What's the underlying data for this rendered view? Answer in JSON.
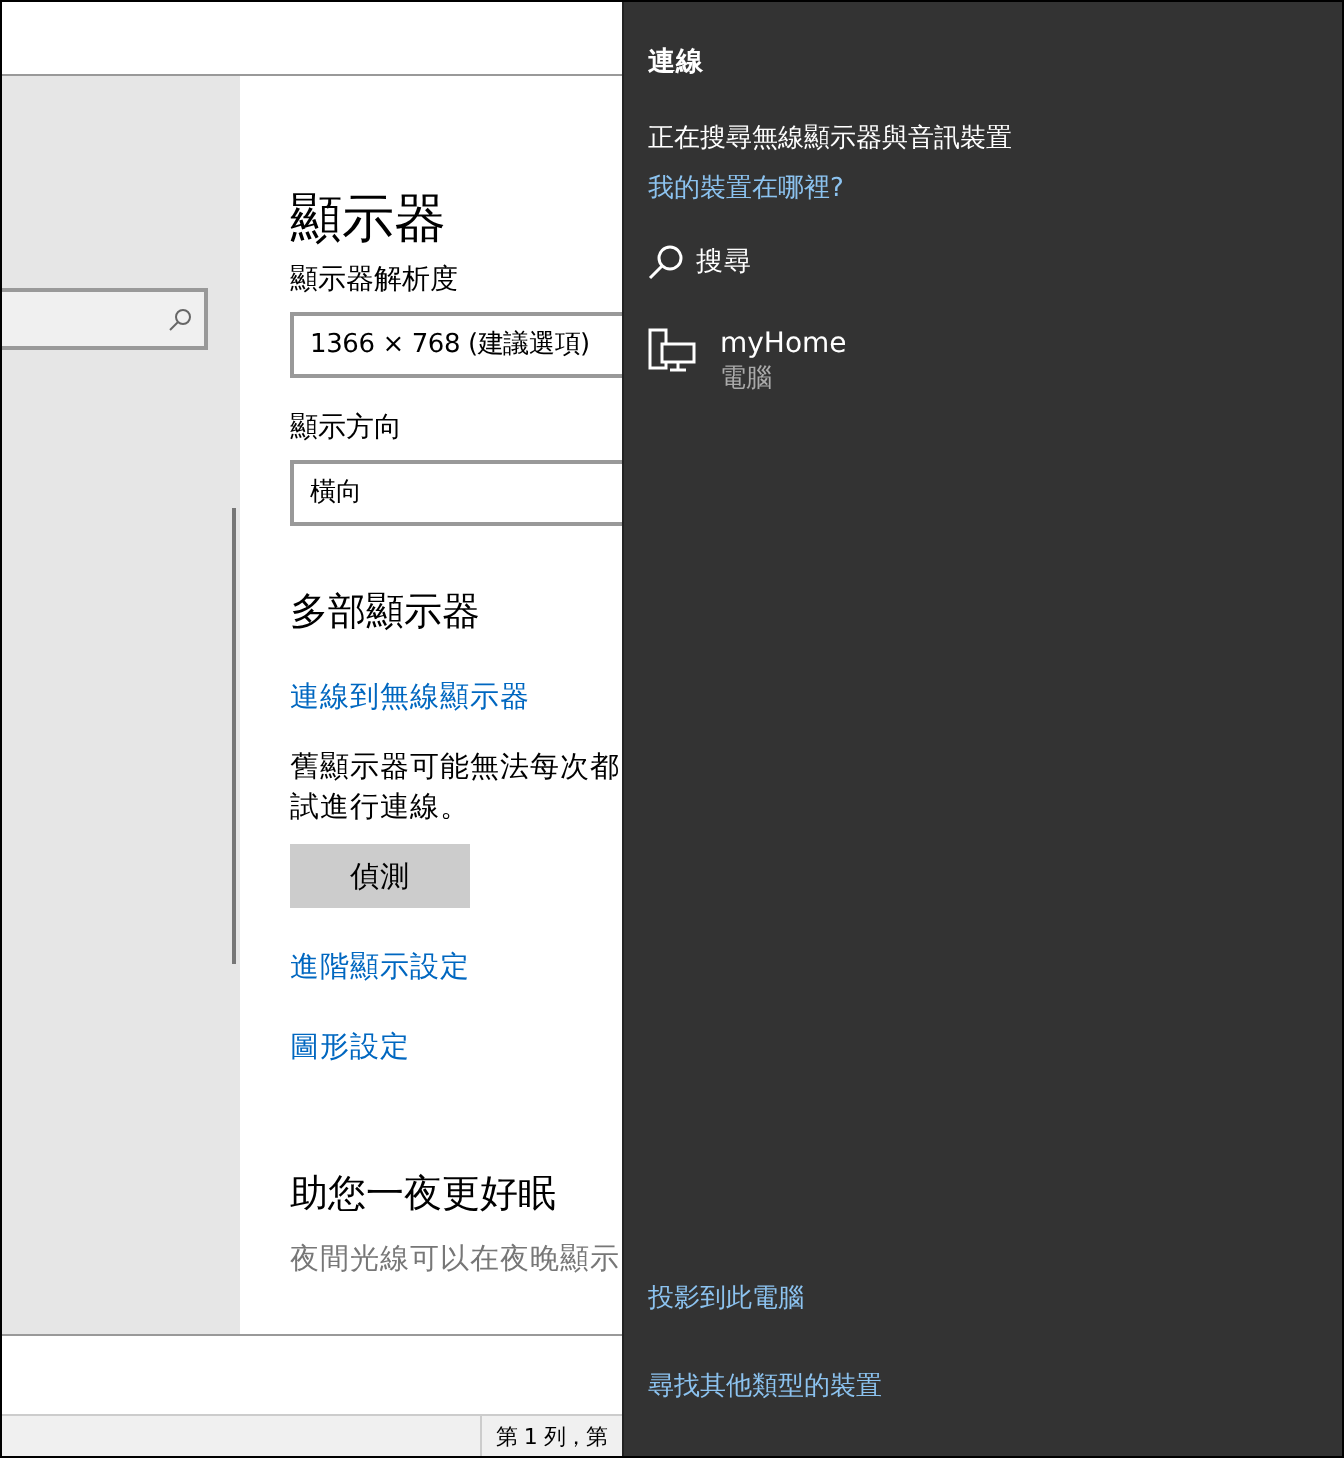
{
  "settings": {
    "title": "顯示器",
    "resolution_label": "顯示器解析度",
    "resolution_value": "1366 × 768 (建議選項)",
    "orientation_label": "顯示方向",
    "orientation_value": "橫向",
    "multi_heading": "多部顯示器",
    "wireless_link": "連線到無線顯示器",
    "note_lines": [
      "舊顯示器可能無法每次都",
      "試進行連線。"
    ],
    "detect_button": "偵測",
    "links": [
      "進階顯示設定",
      "圖形設定"
    ],
    "night_heading": "助您一夜更好眠",
    "night_text": "夜間光線可以在夜晚顯示"
  },
  "status_bar": "第 1 列，第",
  "connect_panel": {
    "title": "連線",
    "status": "正在搜尋無線顯示器與音訊裝置",
    "help_link": "我的裝置在哪裡?",
    "search_label": "搜尋",
    "devices": [
      {
        "name": "myHome",
        "type": "電腦"
      }
    ],
    "footer_links": [
      "投影到此電腦",
      "尋找其他類型的裝置"
    ]
  }
}
